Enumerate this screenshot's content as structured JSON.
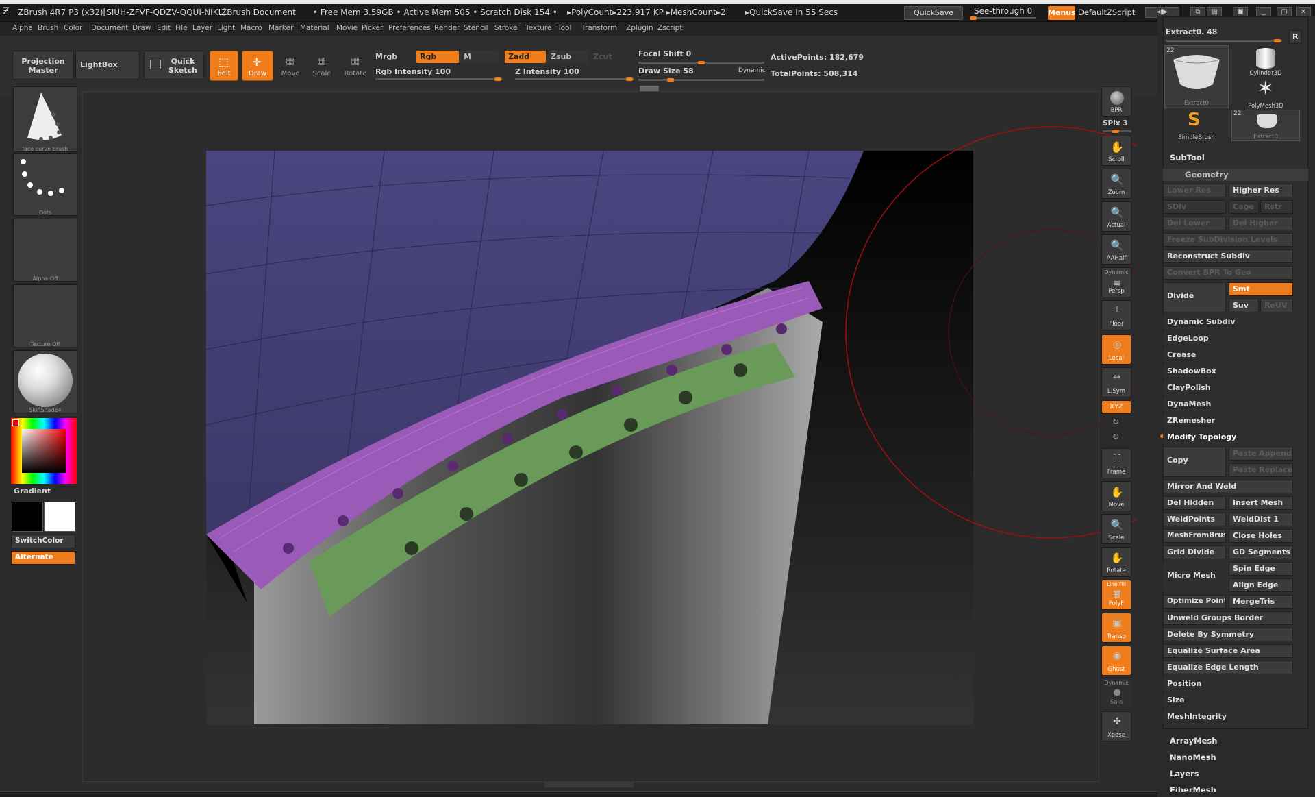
{
  "titlebar": {
    "app": "ZBrush 4R7 P3 (x32)[SIUH-ZFVF-QDZV-QQUI-NIKL]",
    "doc": "ZBrush Document",
    "mem": "• Free Mem 3.59GB • Active Mem 505 • Scratch Disk 154 •",
    "poly": "▸PolyCount▸223.917 KP ▸MeshCount▸2",
    "quicksave_info": "▸QuickSave In 55 Secs",
    "quicksave": "QuickSave",
    "seethrough": "See-through  0",
    "menus": "Menus",
    "script": "DefaultZScript"
  },
  "menubar": [
    "Alpha",
    "Brush",
    "Color",
    "Document",
    "Draw",
    "Edit",
    "File",
    "Layer",
    "Light",
    "Macro",
    "Marker",
    "Material",
    "Movie",
    "Picker",
    "Preferences",
    "Render",
    "Stencil",
    "Stroke",
    "Texture",
    "Tool",
    "Transform",
    "Zplugin",
    "Zscript"
  ],
  "toolbar": {
    "projection_master": "Projection Master",
    "lightbox": "LightBox",
    "quick_sketch": "Quick Sketch",
    "edit": "Edit",
    "draw": "Draw",
    "move": "Move",
    "scale": "Scale",
    "rotate": "Rotate",
    "mrgb": "Mrgb",
    "rgb": "Rgb",
    "m": "M",
    "zadd": "Zadd",
    "zsub": "Zsub",
    "zcut": "Zcut",
    "rgb_intensity": "Rgb Intensity 100",
    "z_intensity": "Z Intensity 100",
    "focal_shift": "Focal Shift 0",
    "draw_size": "Draw Size 58",
    "dynamic": "Dynamic",
    "active_points": "ActivePoints: 182,679",
    "total_points": "TotalPoints: 508,314"
  },
  "left": {
    "brush": "lace curve brush",
    "stroke": "Dots",
    "alpha": "Alpha Off",
    "texture": "Texture Off",
    "material": "SkinShade4",
    "gradient": "Gradient",
    "switchcolor": "SwitchColor",
    "alternate": "Alternate"
  },
  "shelf": [
    "BPR",
    "SPix 3",
    "Scroll",
    "Zoom",
    "Actual",
    "AAHalf",
    "Dynamic",
    "Persp",
    "Floor",
    "Local",
    "L.Sym",
    "XYZ",
    "Frame",
    "Move",
    "Scale",
    "Rotate",
    "Line Fill",
    "PolyF",
    "Transp",
    "Ghost",
    "Dynamic",
    "Solo",
    "Xpose"
  ],
  "right": {
    "extract_slider": "Extract0. 48",
    "r": "R",
    "tool_count_a": "22",
    "tool_count_b": "22",
    "tools": [
      "Extract0",
      "Cylinder3D",
      "PolyMesh3D",
      "SimpleBrush",
      "Extract0"
    ],
    "subtool": "SubTool",
    "geometry": "Geometry",
    "lower_res": "Lower Res",
    "higher_res": "Higher Res",
    "sdiv": "SDiv",
    "cage": "Cage",
    "rstr": "Rstr",
    "del_lower": "Del Lower",
    "del_higher": "Del Higher",
    "freeze": "Freeze SubDivision Levels",
    "reconstruct": "Reconstruct Subdiv",
    "convert_bpr": "Convert BPR To Geo",
    "divide": "Divide",
    "smt": "Smt",
    "suv": "Suv",
    "reuv": "ReUV",
    "dynamic_subdiv": "Dynamic Subdiv",
    "edgeloop": "EdgeLoop",
    "crease": "Crease",
    "shadowbox": "ShadowBox",
    "claypolish": "ClayPolish",
    "dynamesh": "DynaMesh",
    "zremesher": "ZRemesher",
    "modify_topology": "Modify Topology",
    "copy": "Copy",
    "paste_append": "Paste Append",
    "paste_replace": "Paste Replace",
    "mirror_weld": "Mirror And Weld",
    "del_hidden": "Del Hidden",
    "insert_mesh": "Insert Mesh",
    "weldpoints": "WeldPoints",
    "welddist": "WeldDist 1",
    "meshfrombrush": "MeshFromBrush",
    "close_holes": "Close Holes",
    "grid_divide": "Grid Divide",
    "gd_segments": "GD Segments",
    "micro_mesh": "Micro Mesh",
    "spin_edge": "Spin Edge",
    "align_edge": "Align Edge",
    "optimize_points": "Optimize Points",
    "mergetris": "MergeTris",
    "unweld": "Unweld Groups Border",
    "delete_symmetry": "Delete By Symmetry",
    "equalize_surface": "Equalize Surface Area",
    "equalize_edge": "Equalize Edge Length",
    "position": "Position",
    "size": "Size",
    "meshintegrity": "MeshIntegrity",
    "arraymesh": "ArrayMesh",
    "nanomesh": "NanoMesh",
    "layers": "Layers",
    "fibermesh": "FiberMesh"
  }
}
